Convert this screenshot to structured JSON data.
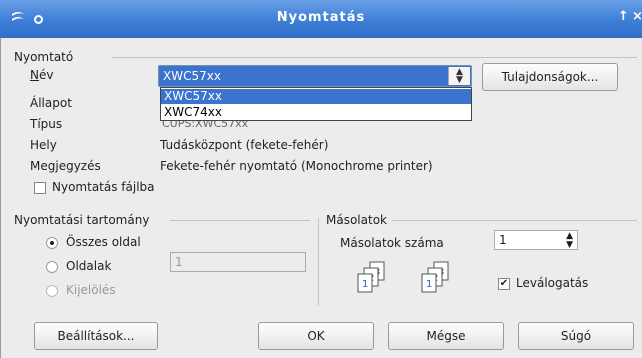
{
  "window": {
    "title": "Nyomtatás",
    "title_controls": [
      "↑",
      "×"
    ]
  },
  "printer": {
    "section_title": "Nyomtató",
    "name_label": "Név",
    "name_value": "XWC57xx",
    "properties_button": "Tulajdonságok...",
    "dropdown_options": [
      "XWC57xx",
      "XWC74xx"
    ],
    "status_label": "Állapot",
    "type_label": "Típus",
    "type_value_partial": "CUPS:XWC57xx",
    "location_label": "Hely",
    "location_value": "Tudásközpont (fekete-fehér)",
    "comment_label": "Megjegyzés",
    "comment_value": "Fekete-fehér nyomtató (Monochrome printer)",
    "print_to_file_label": "Nyomtatás fájlba",
    "print_to_file_checked": false
  },
  "range": {
    "section_title": "Nyomtatási tartomány",
    "all_pages": "Összes oldal",
    "pages": "Oldalak",
    "pages_value": "1",
    "selection": "Kijelölés",
    "selected": "all_pages"
  },
  "copies": {
    "section_title": "Másolatok",
    "count_label": "Másolatok száma",
    "count_value": "1",
    "collate_label": "Leválogatás",
    "collate_checked": true
  },
  "buttons": {
    "settings": "Beállítások...",
    "ok": "OK",
    "cancel": "Mégse",
    "help": "Súgó"
  },
  "colors": {
    "titlebar": "#3d7ed6",
    "selection": "#3a74cf"
  }
}
